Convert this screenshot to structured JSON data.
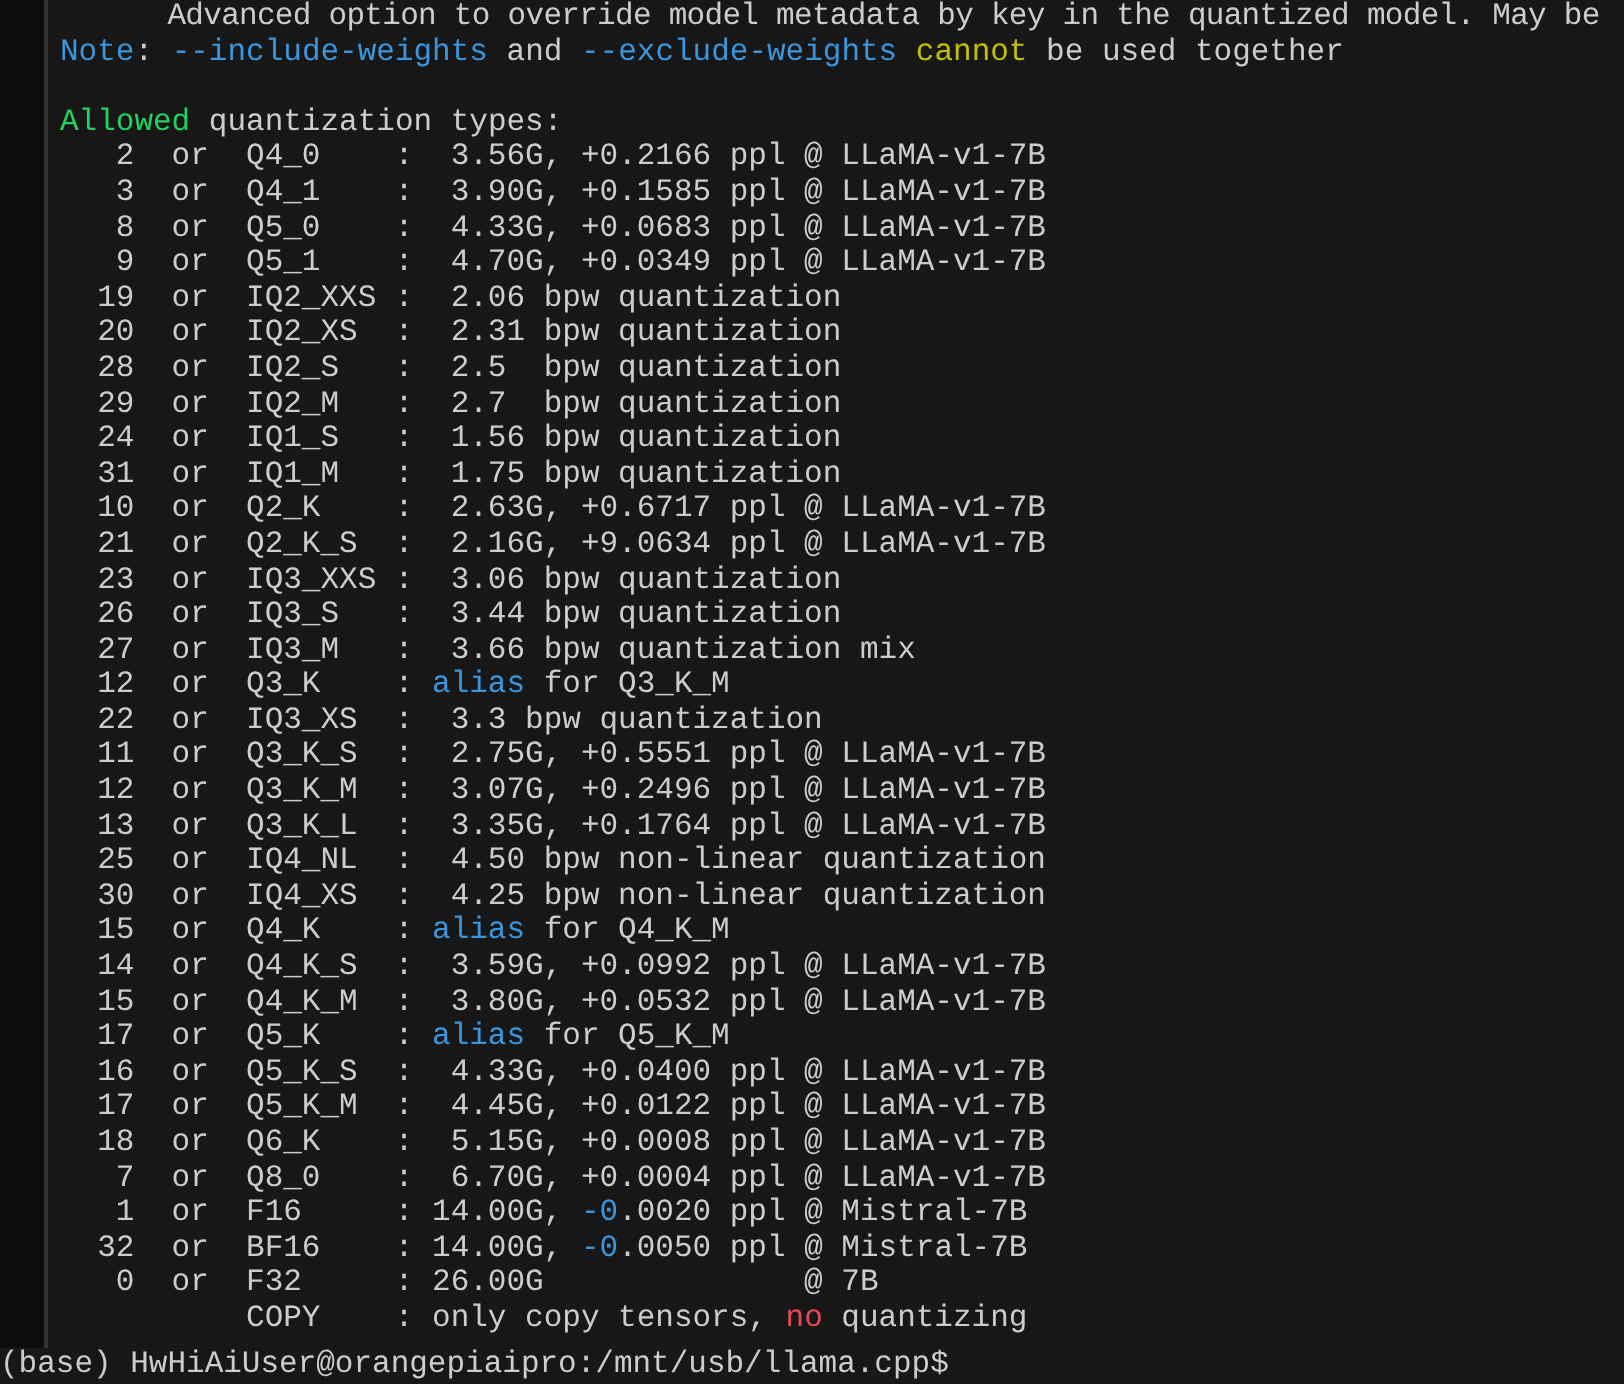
{
  "terminal": {
    "top_line": "      Advanced option to override model metadata by key in the quantized model. May be",
    "note": [
      {
        "text": "Note",
        "kind": "info"
      },
      {
        "text": ": ",
        "kind": "plain"
      },
      {
        "text": "--include-weights",
        "kind": "info"
      },
      {
        "text": " and ",
        "kind": "plain"
      },
      {
        "text": "--exclude-weights",
        "kind": "info"
      },
      {
        "text": " cannot",
        "kind": "warning"
      },
      {
        "text": " be used together",
        "kind": "plain"
      }
    ],
    "heading": [
      {
        "text": "Allowed",
        "kind": "success"
      },
      {
        "text": " quantization types:",
        "kind": "plain"
      }
    ],
    "rows": [
      {
        "segments": [
          {
            "text": "   2  or  Q4_0    :  3.56G, +0.2166 ppl @ LLaMA-v1-7B",
            "kind": "plain"
          }
        ]
      },
      {
        "segments": [
          {
            "text": "   3  or  Q4_1    :  3.90G, +0.1585 ppl @ LLaMA-v1-7B",
            "kind": "plain"
          }
        ]
      },
      {
        "segments": [
          {
            "text": "   8  or  Q5_0    :  4.33G, +0.0683 ppl @ LLaMA-v1-7B",
            "kind": "plain"
          }
        ]
      },
      {
        "segments": [
          {
            "text": "   9  or  Q5_1    :  4.70G, +0.0349 ppl @ LLaMA-v1-7B",
            "kind": "plain"
          }
        ]
      },
      {
        "segments": [
          {
            "text": "  19  or  IQ2_XXS :  2.06 bpw quantization",
            "kind": "plain"
          }
        ]
      },
      {
        "segments": [
          {
            "text": "  20  or  IQ2_XS  :  2.31 bpw quantization",
            "kind": "plain"
          }
        ]
      },
      {
        "segments": [
          {
            "text": "  28  or  IQ2_S   :  2.5  bpw quantization",
            "kind": "plain"
          }
        ]
      },
      {
        "segments": [
          {
            "text": "  29  or  IQ2_M   :  2.7  bpw quantization",
            "kind": "plain"
          }
        ]
      },
      {
        "segments": [
          {
            "text": "  24  or  IQ1_S   :  1.56 bpw quantization",
            "kind": "plain"
          }
        ]
      },
      {
        "segments": [
          {
            "text": "  31  or  IQ1_M   :  1.75 bpw quantization",
            "kind": "plain"
          }
        ]
      },
      {
        "segments": [
          {
            "text": "  10  or  Q2_K    :  2.63G, +0.6717 ppl @ LLaMA-v1-7B",
            "kind": "plain"
          }
        ]
      },
      {
        "segments": [
          {
            "text": "  21  or  Q2_K_S  :  2.16G, +9.0634 ppl @ LLaMA-v1-7B",
            "kind": "plain"
          }
        ]
      },
      {
        "segments": [
          {
            "text": "  23  or  IQ3_XXS :  3.06 bpw quantization",
            "kind": "plain"
          }
        ]
      },
      {
        "segments": [
          {
            "text": "  26  or  IQ3_S   :  3.44 bpw quantization",
            "kind": "plain"
          }
        ]
      },
      {
        "segments": [
          {
            "text": "  27  or  IQ3_M   :  3.66 bpw quantization mix",
            "kind": "plain"
          }
        ]
      },
      {
        "segments": [
          {
            "text": "  12  or  Q3_K    : ",
            "kind": "plain"
          },
          {
            "text": "alias",
            "kind": "info"
          },
          {
            "text": " for Q3_K_M",
            "kind": "plain"
          }
        ]
      },
      {
        "segments": [
          {
            "text": "  22  or  IQ3_XS  :  3.3 bpw quantization",
            "kind": "plain"
          }
        ]
      },
      {
        "segments": [
          {
            "text": "  11  or  Q3_K_S  :  2.75G, +0.5551 ppl @ LLaMA-v1-7B",
            "kind": "plain"
          }
        ]
      },
      {
        "segments": [
          {
            "text": "  12  or  Q3_K_M  :  3.07G, +0.2496 ppl @ LLaMA-v1-7B",
            "kind": "plain"
          }
        ]
      },
      {
        "segments": [
          {
            "text": "  13  or  Q3_K_L  :  3.35G, +0.1764 ppl @ LLaMA-v1-7B",
            "kind": "plain"
          }
        ]
      },
      {
        "segments": [
          {
            "text": "  25  or  IQ4_NL  :  4.50 bpw non-linear quantization",
            "kind": "plain"
          }
        ]
      },
      {
        "segments": [
          {
            "text": "  30  or  IQ4_XS  :  4.25 bpw non-linear quantization",
            "kind": "plain"
          }
        ]
      },
      {
        "segments": [
          {
            "text": "  15  or  Q4_K    : ",
            "kind": "plain"
          },
          {
            "text": "alias",
            "kind": "info"
          },
          {
            "text": " for Q4_K_M",
            "kind": "plain"
          }
        ]
      },
      {
        "segments": [
          {
            "text": "  14  or  Q4_K_S  :  3.59G, +0.0992 ppl @ LLaMA-v1-7B",
            "kind": "plain"
          }
        ]
      },
      {
        "segments": [
          {
            "text": "  15  or  Q4_K_M  :  3.80G, +0.0532 ppl @ LLaMA-v1-7B",
            "kind": "plain"
          }
        ]
      },
      {
        "segments": [
          {
            "text": "  17  or  Q5_K    : ",
            "kind": "plain"
          },
          {
            "text": "alias",
            "kind": "info"
          },
          {
            "text": " for Q5_K_M",
            "kind": "plain"
          }
        ]
      },
      {
        "segments": [
          {
            "text": "  16  or  Q5_K_S  :  4.33G, +0.0400 ppl @ LLaMA-v1-7B",
            "kind": "plain"
          }
        ]
      },
      {
        "segments": [
          {
            "text": "  17  or  Q5_K_M  :  4.45G, +0.0122 ppl @ LLaMA-v1-7B",
            "kind": "plain"
          }
        ]
      },
      {
        "segments": [
          {
            "text": "  18  or  Q6_K    :  5.15G, +0.0008 ppl @ LLaMA-v1-7B",
            "kind": "plain"
          }
        ]
      },
      {
        "segments": [
          {
            "text": "   7  or  Q8_0    :  6.70G, +0.0004 ppl @ LLaMA-v1-7B",
            "kind": "plain"
          }
        ]
      },
      {
        "segments": [
          {
            "text": "   1  or  F16     : 14.00G, ",
            "kind": "plain"
          },
          {
            "text": "-0",
            "kind": "info"
          },
          {
            "text": ".0020 ppl @ Mistral-7B",
            "kind": "plain"
          }
        ]
      },
      {
        "segments": [
          {
            "text": "  32  or  BF16    : 14.00G, ",
            "kind": "plain"
          },
          {
            "text": "-0",
            "kind": "info"
          },
          {
            "text": ".0050 ppl @ Mistral-7B",
            "kind": "plain"
          }
        ]
      },
      {
        "segments": [
          {
            "text": "   0  or  F32     : 26.00G              @ 7B",
            "kind": "plain"
          }
        ]
      },
      {
        "segments": [
          {
            "text": "          COPY    : only copy tensors, ",
            "kind": "plain"
          },
          {
            "text": "no",
            "kind": "error"
          },
          {
            "text": " quantizing",
            "kind": "plain"
          }
        ]
      }
    ],
    "prompt": "(base) HwHiAiUser@orangepiaipro:/mnt/usb/llama.cpp$"
  }
}
